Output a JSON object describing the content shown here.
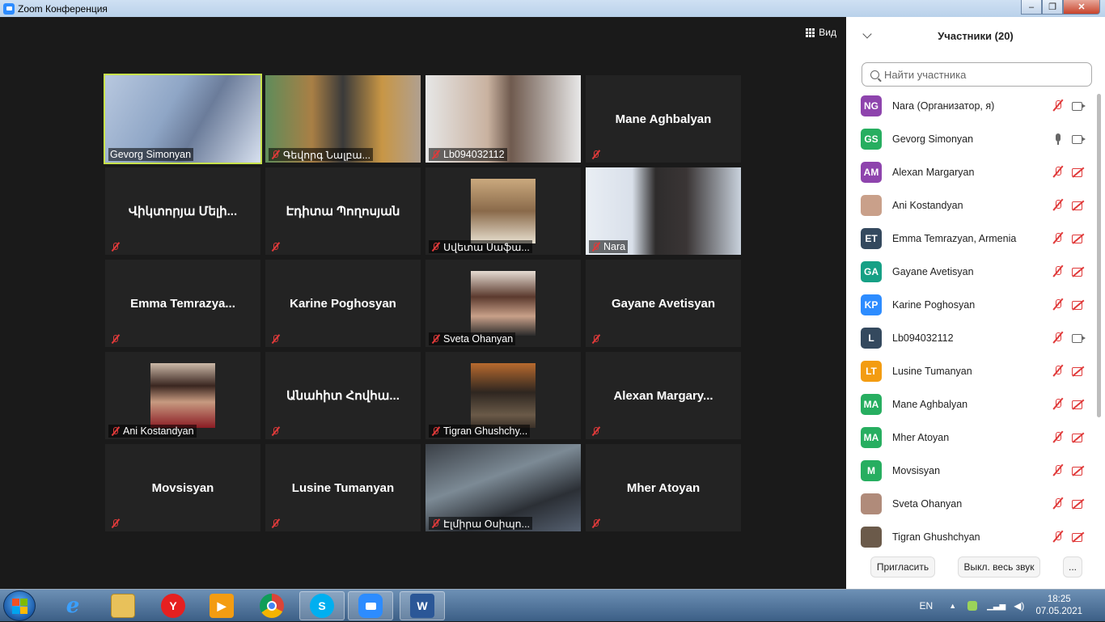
{
  "window": {
    "title": "Zoom Конференция"
  },
  "view_button": {
    "label": "Вид"
  },
  "tiles": [
    {
      "name": "Gevorg Simonyan",
      "kind": "video",
      "active": true,
      "muted": false
    },
    {
      "name": "Գեվորգ Նալբա...",
      "kind": "video",
      "muted": true
    },
    {
      "name": "Lb094032112",
      "kind": "video",
      "muted": true
    },
    {
      "name": "Mane Aghbalyan",
      "kind": "name",
      "muted": true
    },
    {
      "name": "Վիկտորյա Մելի...",
      "kind": "name",
      "muted": true
    },
    {
      "name": "Էդիտա Պողոսյան",
      "kind": "name",
      "muted": true
    },
    {
      "name": "Սվետա Սաֆա...",
      "kind": "photo",
      "muted": true
    },
    {
      "name": "Nara",
      "kind": "video",
      "muted": true
    },
    {
      "name": "Emma  Temrazya...",
      "kind": "name",
      "muted": true
    },
    {
      "name": "Karine Poghosyan",
      "kind": "name",
      "muted": true
    },
    {
      "name": "Sveta Ohanyan",
      "kind": "photo",
      "muted": true
    },
    {
      "name": "Gayane Avetisyan",
      "kind": "name",
      "muted": true
    },
    {
      "name": "Ani Kostandyan",
      "kind": "photo",
      "muted": true
    },
    {
      "name": "Անահիտ Հովհա...",
      "kind": "name",
      "muted": true
    },
    {
      "name": "Tigran Ghushchy...",
      "kind": "photo",
      "muted": true
    },
    {
      "name": "Alexan  Margary...",
      "kind": "name",
      "muted": true
    },
    {
      "name": "Movsisyan",
      "kind": "name",
      "muted": true
    },
    {
      "name": "Lusine Tumanyan",
      "kind": "name",
      "muted": true
    },
    {
      "name": "Էլմիրա Օսիպո...",
      "kind": "video",
      "muted": true
    },
    {
      "name": "Mher Atoyan",
      "kind": "name",
      "muted": true
    }
  ],
  "participants_panel": {
    "title": "Участники (20)",
    "search_placeholder": "Найти участника",
    "participants": [
      {
        "initials": "NG",
        "color": "#8e44ad",
        "name": "Nara (Организатор, я)",
        "mic": "muted",
        "cam": "on"
      },
      {
        "initials": "GS",
        "color": "#27ae60",
        "name": "Gevorg Simonyan",
        "mic": "on",
        "cam": "on"
      },
      {
        "initials": "AM",
        "color": "#8e44ad",
        "name": "Alexan Margaryan",
        "mic": "muted",
        "cam": "off"
      },
      {
        "initials": "",
        "color": "#c9a08a",
        "name": "Ani Kostandyan",
        "mic": "muted",
        "cam": "off"
      },
      {
        "initials": "ET",
        "color": "#34495e",
        "name": "Emma Temrazyan, Armenia",
        "mic": "muted",
        "cam": "off"
      },
      {
        "initials": "GA",
        "color": "#16a085",
        "name": "Gayane Avetisyan",
        "mic": "muted",
        "cam": "off"
      },
      {
        "initials": "KP",
        "color": "#2d8cff",
        "name": "Karine Poghosyan",
        "mic": "muted",
        "cam": "off"
      },
      {
        "initials": "L",
        "color": "#34495e",
        "name": "Lb094032112",
        "mic": "muted",
        "cam": "on"
      },
      {
        "initials": "LT",
        "color": "#f39c12",
        "name": "Lusine Tumanyan",
        "mic": "muted",
        "cam": "off"
      },
      {
        "initials": "MA",
        "color": "#27ae60",
        "name": "Mane Aghbalyan",
        "mic": "muted",
        "cam": "off"
      },
      {
        "initials": "MA",
        "color": "#27ae60",
        "name": "Mher Atoyan",
        "mic": "muted",
        "cam": "off"
      },
      {
        "initials": "M",
        "color": "#27ae60",
        "name": "Movsisyan",
        "mic": "muted",
        "cam": "off"
      },
      {
        "initials": "",
        "color": "#b08b7a",
        "name": "Sveta Ohanyan",
        "mic": "muted",
        "cam": "off"
      },
      {
        "initials": "",
        "color": "#6b5a4a",
        "name": "Tigran Ghushchyan",
        "mic": "muted",
        "cam": "off"
      }
    ],
    "invite_label": "Пригласить",
    "mute_all_label": "Выкл. весь звук",
    "more_label": "..."
  },
  "taskbar": {
    "language": "EN",
    "time": "18:25",
    "date": "07.05.2021",
    "word_label": "W"
  }
}
